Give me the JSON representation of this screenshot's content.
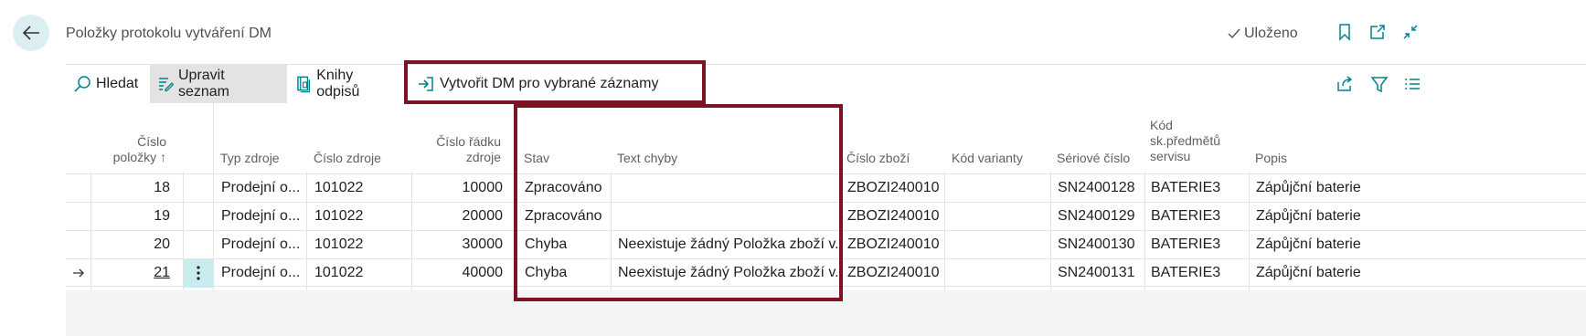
{
  "header": {
    "title": "Položky protokolu vytváření DM",
    "saved_label": "Uloženo"
  },
  "actions": {
    "search": "Hledat",
    "edit_list": "Upravit seznam",
    "depreciation_books": "Knihy odpisů",
    "create_dm": "Vytvořit DM pro vybrané záznamy"
  },
  "columns": {
    "entry_no": "Číslo položky ↑",
    "source_type": "Typ zdroje",
    "source_no": "Číslo zdroje",
    "source_line_no": "Číslo řádku zdroje",
    "status": "Stav",
    "error_text": "Text chyby",
    "item_no": "Číslo zboží",
    "variant_code": "Kód varianty",
    "serial_no": "Sériové číslo",
    "service_group_code": "Kód sk.předmětů servisu",
    "description": "Popis"
  },
  "rows": [
    {
      "entry_no": "18",
      "source_type": "Prodejní o...",
      "source_no": "101022",
      "source_line_no": "10000",
      "status": "Zpracováno",
      "error_text": "",
      "item_no": "ZBOZI240010",
      "variant_code": "",
      "serial_no": "SN2400128",
      "service_group_code": "BATERIE3",
      "description": "Zápůjční baterie"
    },
    {
      "entry_no": "19",
      "source_type": "Prodejní o...",
      "source_no": "101022",
      "source_line_no": "20000",
      "status": "Zpracováno",
      "error_text": "",
      "item_no": "ZBOZI240010",
      "variant_code": "",
      "serial_no": "SN2400129",
      "service_group_code": "BATERIE3",
      "description": "Zápůjční baterie"
    },
    {
      "entry_no": "20",
      "source_type": "Prodejní o...",
      "source_no": "101022",
      "source_line_no": "30000",
      "status": "Chyba",
      "error_text": "Neexistuje žádný Položka zboží v...",
      "item_no": "ZBOZI240010",
      "variant_code": "",
      "serial_no": "SN2400130",
      "service_group_code": "BATERIE3",
      "description": "Zápůjční baterie"
    },
    {
      "entry_no": "21",
      "source_type": "Prodejní o...",
      "source_no": "101022",
      "source_line_no": "40000",
      "status": "Chyba",
      "error_text": "Neexistuje žádný Položka zboží v...",
      "item_no": "ZBOZI240010",
      "variant_code": "",
      "serial_no": "SN2400131",
      "service_group_code": "BATERIE3",
      "description": "Zápůjční baterie"
    }
  ],
  "colors": {
    "accent": "#00838f",
    "highlight_border": "#7b1323",
    "back_button_bg": "#dbeef2",
    "selected_cell_bg": "#c8ecef"
  },
  "icons": [
    "back-arrow-icon",
    "checkmark-icon",
    "bookmark-icon",
    "open-new-window-icon",
    "collapse-icon",
    "search-icon",
    "edit-list-icon",
    "book-icon",
    "create-arrow-icon",
    "share-icon",
    "filter-icon",
    "list-view-icon",
    "row-pointer-icon",
    "ellipsis-vertical-icon"
  ]
}
